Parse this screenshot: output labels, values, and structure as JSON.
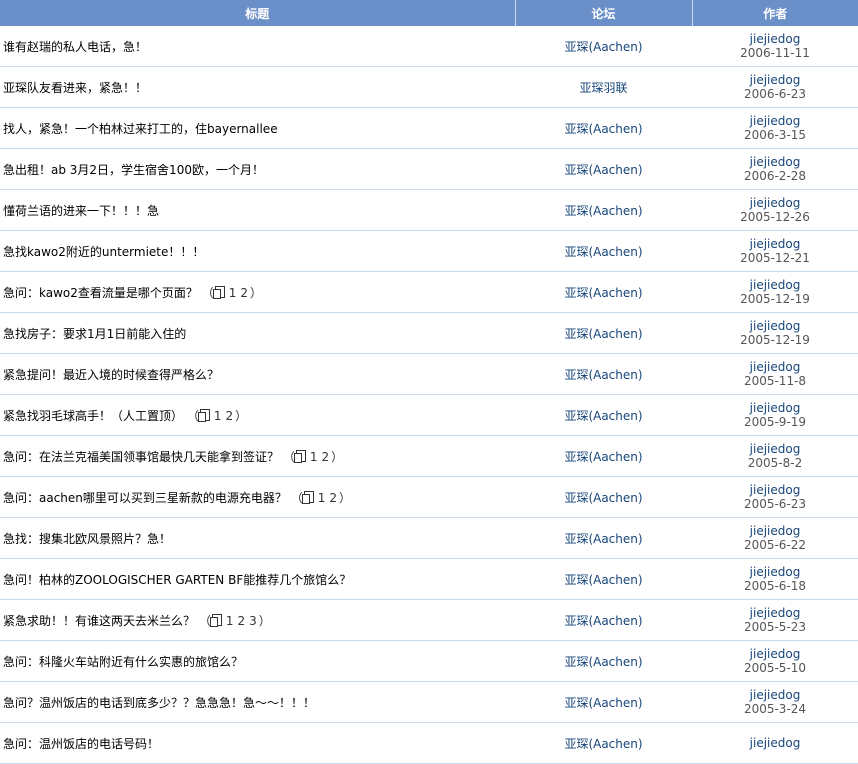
{
  "header": {
    "col_title": "标题",
    "col_forum": "论坛",
    "col_author": "作者"
  },
  "rows": [
    {
      "title": "谁有赵瑞的私人电话，急！",
      "pages": [],
      "forum": "亚琛(Aachen)",
      "author": "jiejiedog",
      "date": "2006-11-11"
    },
    {
      "title": "亚琛队友看进来，紧急！！",
      "pages": [],
      "forum": "亚琛羽联",
      "author": "jiejiedog",
      "date": "2006-6-23"
    },
    {
      "title": "找人，紧急！一个柏林过来打工的，住bayernallee",
      "pages": [],
      "forum": "亚琛(Aachen)",
      "author": "jiejiedog",
      "date": "2006-3-15"
    },
    {
      "title": "急出租！ab 3月2日，学生宿舍100欧，一个月！",
      "pages": [],
      "forum": "亚琛(Aachen)",
      "author": "jiejiedog",
      "date": "2006-2-28"
    },
    {
      "title": "懂荷兰语的进来一下！！！急",
      "pages": [],
      "forum": "亚琛(Aachen)",
      "author": "jiejiedog",
      "date": "2005-12-26"
    },
    {
      "title": "急找kawo2附近的untermiete！！！",
      "pages": [],
      "forum": "亚琛(Aachen)",
      "author": "jiejiedog",
      "date": "2005-12-21"
    },
    {
      "title": "急问：kawo2查看流量是哪个页面？",
      "pages": [
        "1",
        "2"
      ],
      "forum": "亚琛(Aachen)",
      "author": "jiejiedog",
      "date": "2005-12-19"
    },
    {
      "title": "急找房子：要求1月1日前能入住的",
      "pages": [],
      "forum": "亚琛(Aachen)",
      "author": "jiejiedog",
      "date": "2005-12-19"
    },
    {
      "title": "紧急提问！最近入境的时候查得严格么？",
      "pages": [],
      "forum": "亚琛(Aachen)",
      "author": "jiejiedog",
      "date": "2005-11-8"
    },
    {
      "title": "紧急找羽毛球高手！（人工置顶）",
      "pages": [
        "1",
        "2"
      ],
      "forum": "亚琛(Aachen)",
      "author": "jiejiedog",
      "date": "2005-9-19"
    },
    {
      "title": "急问：在法兰克福美国领事馆最快几天能拿到签证？",
      "pages": [
        "1",
        "2"
      ],
      "forum": "亚琛(Aachen)",
      "author": "jiejiedog",
      "date": "2005-8-2"
    },
    {
      "title": "急问：aachen哪里可以买到三星新款的电源充电器？",
      "pages": [
        "1",
        "2"
      ],
      "forum": "亚琛(Aachen)",
      "author": "jiejiedog",
      "date": "2005-6-23"
    },
    {
      "title": "急找：搜集北欧风景照片？急！",
      "pages": [],
      "forum": "亚琛(Aachen)",
      "author": "jiejiedog",
      "date": "2005-6-22"
    },
    {
      "title": "急问！柏林的ZOOLOGISCHER GARTEN BF能推荐几个旅馆么？",
      "pages": [],
      "forum": "亚琛(Aachen)",
      "author": "jiejiedog",
      "date": "2005-6-18"
    },
    {
      "title": "紧急求助！！有谁这两天去米兰么？",
      "pages": [
        "1",
        "2",
        "3"
      ],
      "forum": "亚琛(Aachen)",
      "author": "jiejiedog",
      "date": "2005-5-23"
    },
    {
      "title": "急问：科隆火车站附近有什么实惠的旅馆么？",
      "pages": [],
      "forum": "亚琛(Aachen)",
      "author": "jiejiedog",
      "date": "2005-5-10"
    },
    {
      "title": "急问？温州饭店的电话到底多少？？急急急！急～～！！！",
      "pages": [],
      "forum": "亚琛(Aachen)",
      "author": "jiejiedog",
      "date": "2005-3-24"
    },
    {
      "title": "急问：温州饭店的电话号码！",
      "pages": [],
      "forum": "亚琛(Aachen)",
      "author": "jiejiedog",
      "date": ""
    }
  ]
}
